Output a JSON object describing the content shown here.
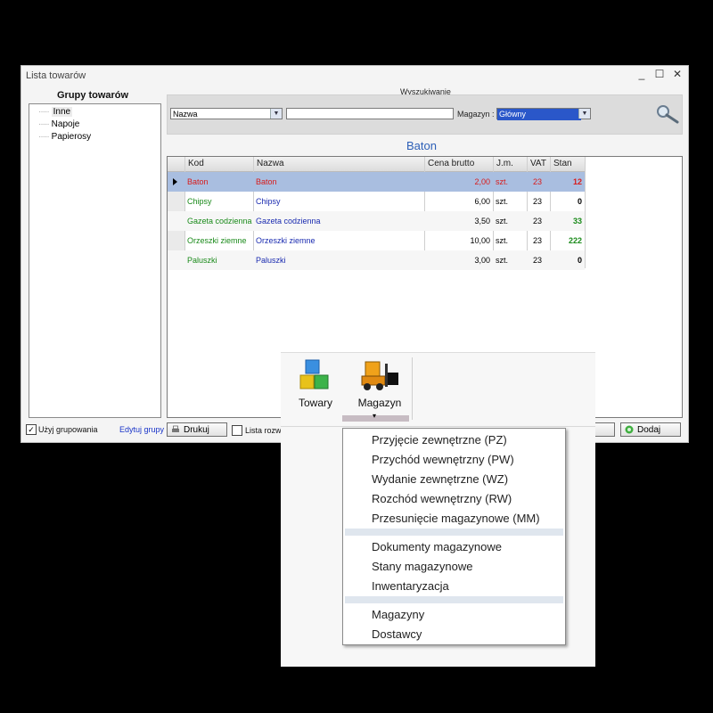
{
  "window": {
    "title": "Lista towarów",
    "btn_min": "_",
    "btn_max": "☐",
    "btn_close": "✕"
  },
  "groups": {
    "title": "Grupy towarów",
    "items": [
      "Inne",
      "Napoje",
      "Papierosy"
    ],
    "use_grouping_label": "Użyj grupowania",
    "use_grouping_checked": "✓",
    "edit_link": "Edytuj grupy"
  },
  "search": {
    "caption": "Wyszukiwanie",
    "field_value": "Nazwa",
    "text_value": "",
    "magazyn_label": "Magazyn :",
    "magazyn_value": "Główny"
  },
  "grid_title": "Baton",
  "grid": {
    "columns": [
      "Kod",
      "Nazwa",
      "Cena brutto",
      "J.m.",
      "VAT",
      "Stan"
    ],
    "rows": [
      {
        "kod": "Baton",
        "nazwa": "Baton",
        "cena": "2,00",
        "jm": "szt.",
        "vat": "23",
        "stan": "12"
      },
      {
        "kod": "Chipsy",
        "nazwa": "Chipsy",
        "cena": "6,00",
        "jm": "szt.",
        "vat": "23",
        "stan": "0"
      },
      {
        "kod": "Gazeta codzienna",
        "nazwa": "Gazeta codzienna",
        "cena": "3,50",
        "jm": "szt.",
        "vat": "23",
        "stan": "33"
      },
      {
        "kod": "Orzeszki ziemne",
        "nazwa": "Orzeszki ziemne",
        "cena": "10,00",
        "jm": "szt.",
        "vat": "23",
        "stan": "222"
      },
      {
        "kod": "Paluszki",
        "nazwa": "Paluszki",
        "cena": "3,00",
        "jm": "szt.",
        "vat": "23",
        "stan": "0"
      }
    ]
  },
  "buttons": {
    "print": "Drukuj",
    "expand_label": "Lista rozwin",
    "add": "Dodaj"
  },
  "ribbon": {
    "towary": "Towary",
    "magazyn": "Magazyn",
    "dropdown_arrow": "▾"
  },
  "menu": {
    "section1": [
      "Przyjęcie zewnętrzne (PZ)",
      "Przychód wewnętrzny (PW)",
      "Wydanie zewnętrzne (WZ)",
      "Rozchód wewnętrzny (RW)",
      "Przesunięcie magazynowe (MM)"
    ],
    "section2": [
      "Dokumenty magazynowe",
      "Stany magazynowe",
      "Inwentaryzacja"
    ],
    "section3": [
      "Magazyny",
      "Dostawcy"
    ]
  },
  "colors": {
    "selected_row": "#a9bee0",
    "kod_text": "#1a8a1a",
    "nazwa_text": "#1a2bb0",
    "selected_text": "#d81b1b",
    "stock_positive": "#1a8a1a",
    "heading": "#2c5fb7"
  }
}
